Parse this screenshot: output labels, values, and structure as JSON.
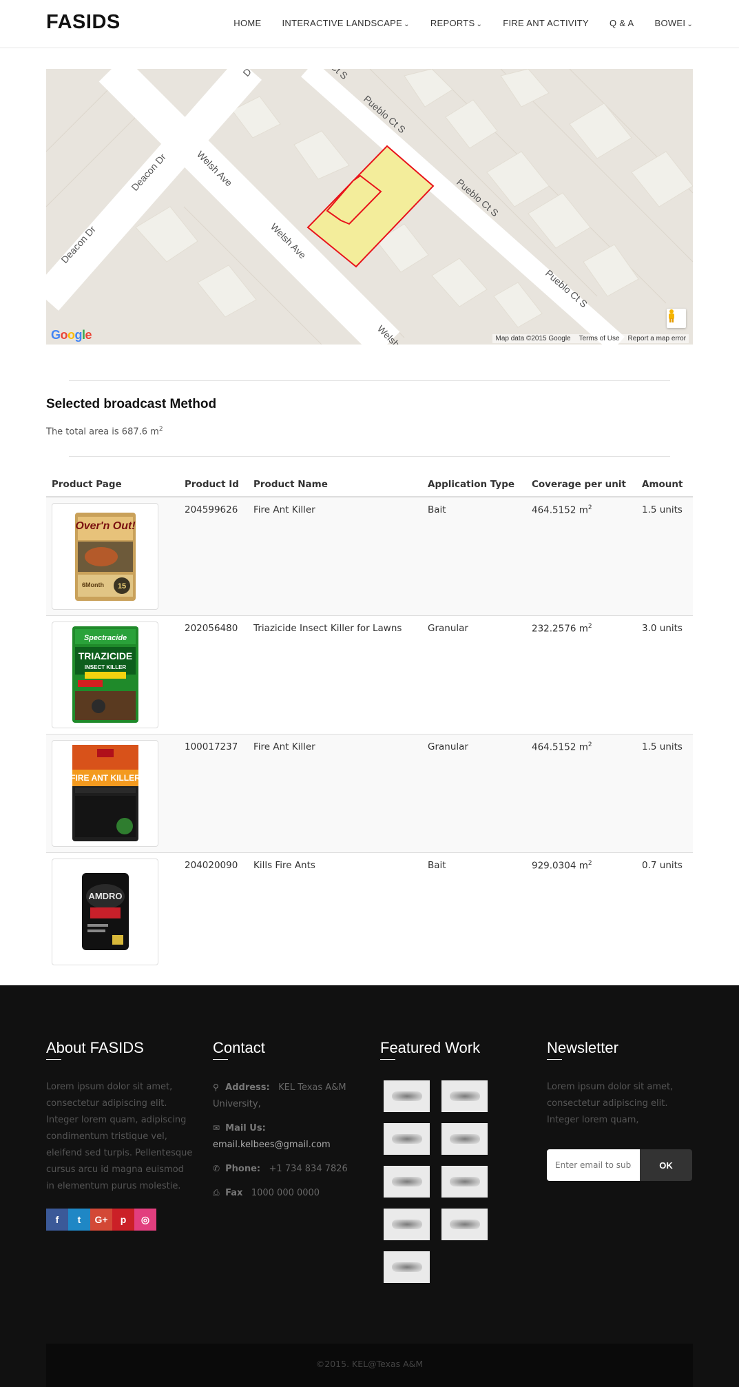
{
  "brand": "FASIDS",
  "nav": [
    {
      "label": "HOME",
      "caret": false
    },
    {
      "label": "INTERACTIVE LANDSCAPE",
      "caret": true
    },
    {
      "label": "REPORTS",
      "caret": true
    },
    {
      "label": "FIRE ANT ACTIVITY",
      "caret": false
    },
    {
      "label": "Q & A",
      "caret": false
    },
    {
      "label": "BOWEI",
      "caret": true
    }
  ],
  "map": {
    "street_labels": [
      "Deacon Dr",
      "Deacon Dr",
      "Welsh Ave",
      "Welsh Ave",
      "Welsh",
      "Pueblo Ct S",
      "Pueblo Ct S",
      "Pueblo Ct S",
      "Ct S",
      "D"
    ],
    "attribution": [
      "Map data ©2015 Google",
      "Terms of Use",
      "Report a map error"
    ],
    "logo": "Google",
    "colors": {
      "land": "#e8e4dd",
      "road": "#ffffff",
      "building": "#f1f0ea",
      "parcel_fill": "#f3ed9b",
      "parcel_stroke": "#e8131b"
    }
  },
  "section": {
    "title": "Selected broadcast Method",
    "area_prefix": "The total area is 687.6 m",
    "area_sup": "2"
  },
  "table": {
    "headers": [
      "Product Page",
      "Product Id",
      "Product Name",
      "Application Type",
      "Coverage per unit",
      "Amount"
    ],
    "rows": [
      {
        "product_id": "204599626",
        "name": "Fire Ant Killer",
        "type": "Bait",
        "coverage": "464.5152 m",
        "coverage_sup": "2",
        "amount": "1.5 units",
        "image": "overn-out-bag"
      },
      {
        "product_id": "202056480",
        "name": "Triazicide Insect Killer for Lawns",
        "type": "Granular",
        "coverage": "232.2576 m",
        "coverage_sup": "2",
        "amount": "3.0 units",
        "image": "triazicide-bag"
      },
      {
        "product_id": "100017237",
        "name": "Fire Ant Killer",
        "type": "Granular",
        "coverage": "464.5152 m",
        "coverage_sup": "2",
        "amount": "1.5 units",
        "image": "ortho-fire-ant-bag"
      },
      {
        "product_id": "204020090",
        "name": "Kills Fire Ants",
        "type": "Bait",
        "coverage": "929.0304 m",
        "coverage_sup": "2",
        "amount": "0.7 units",
        "image": "amdro-bag"
      }
    ]
  },
  "footer": {
    "about": {
      "title": "About FASIDS",
      "text": "Lorem ipsum dolor sit amet, consectetur adipiscing elit. Integer lorem quam, adipiscing condimentum tristique vel, eleifend sed turpis. Pellentesque cursus arcu id magna euismod in elementum purus molestie.",
      "social": [
        {
          "icon": "facebook-icon",
          "glyph": "f",
          "color": "#3b5998"
        },
        {
          "icon": "twitter-icon",
          "glyph": "t",
          "color": "#1f87c5"
        },
        {
          "icon": "google-plus-icon",
          "glyph": "G+",
          "color": "#d34836"
        },
        {
          "icon": "pinterest-icon",
          "glyph": "p",
          "color": "#cb2027"
        },
        {
          "icon": "dribbble-icon",
          "glyph": "◎",
          "color": "#e23e7e"
        }
      ]
    },
    "contact": {
      "title": "Contact",
      "address_label": "Address:",
      "address": "KEL Texas A&M University,",
      "mail_label": "Mail Us:",
      "mail": "email.kelbees@gmail.com",
      "phone_label": "Phone:",
      "phone": "+1 734 834 7826",
      "fax_label": "Fax",
      "fax": "1000 000 0000"
    },
    "featured": {
      "title": "Featured Work",
      "count": 9
    },
    "newsletter": {
      "title": "Newsletter",
      "text": "Lorem ipsum dolor sit amet, consectetur adipiscing elit. Integer lorem quam,",
      "placeholder": "Enter email to subscribe",
      "button": "OK"
    },
    "copyright": "©2015. KEL@Texas A&M"
  }
}
